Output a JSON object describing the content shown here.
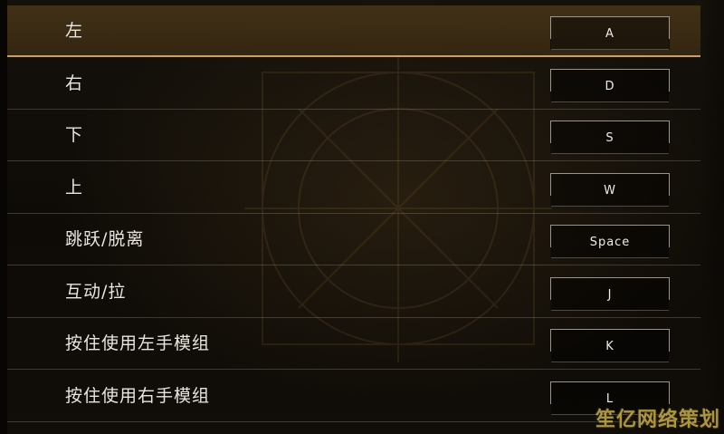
{
  "keybindings": [
    {
      "action": "左",
      "key": "A",
      "selected": true
    },
    {
      "action": "右",
      "key": "D",
      "selected": false
    },
    {
      "action": "下",
      "key": "S",
      "selected": false
    },
    {
      "action": "上",
      "key": "W",
      "selected": false
    },
    {
      "action": "跳跃/脱离",
      "key": "Space",
      "selected": false
    },
    {
      "action": "互动/拉",
      "key": "J",
      "selected": false
    },
    {
      "action": "按住使用左手模组",
      "key": "K",
      "selected": false
    },
    {
      "action": "按住使用右手模组",
      "key": "L",
      "selected": false
    }
  ],
  "watermark": "笙亿网络策划",
  "colors": {
    "accent": "#c9a15c",
    "selected_row": "#463418",
    "text": "#e9e6df",
    "watermark": "#c7ad49"
  }
}
